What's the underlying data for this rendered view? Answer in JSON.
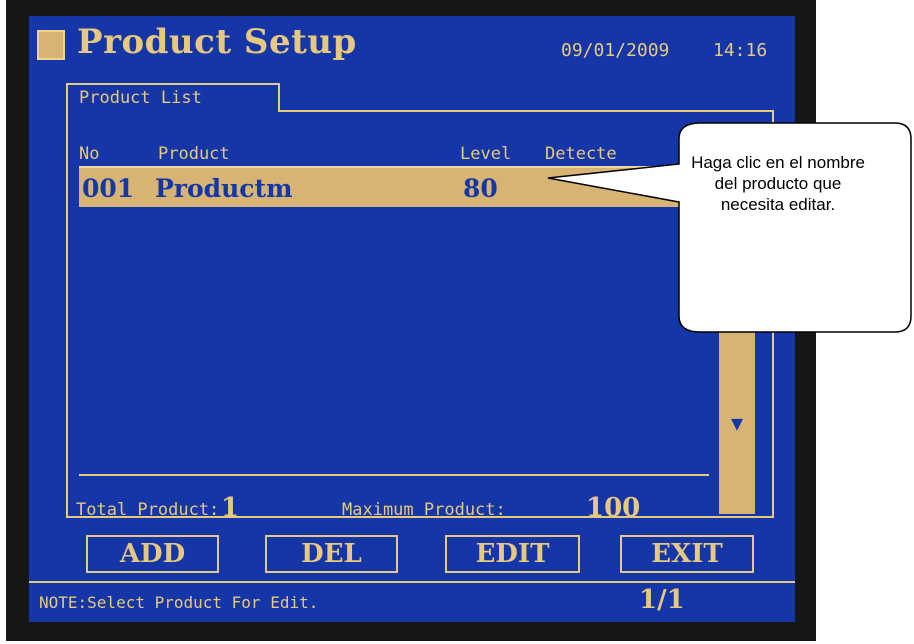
{
  "header": {
    "title": "Product Setup",
    "date": "09/01/2009",
    "time": "14:16"
  },
  "tab": {
    "label": "Product List"
  },
  "columns": {
    "no": "No",
    "product": "Product",
    "level": "Level",
    "detected": "Detecte"
  },
  "rows": [
    {
      "no": "001",
      "product": "Productm",
      "level": "80"
    }
  ],
  "totals": {
    "total_label": "Total Product:",
    "total_value": "1",
    "max_label": "Maximum Product:",
    "max_value": "100"
  },
  "buttons": {
    "add": "ADD",
    "del": "DEL",
    "edit": "EDIT",
    "exit": "EXIT"
  },
  "status": {
    "note": "NOTE:Select Product For Edit.",
    "page": "1/1"
  },
  "scrollbar": {
    "down_icon": "down-arrow-icon"
  },
  "callout": {
    "text": "Haga clic en el nombre del producto que necesita editar."
  },
  "colors": {
    "screen_bg": "#1536a6",
    "accent": "#e6c880",
    "highlight": "#d7b473",
    "bezel": "#141618"
  }
}
